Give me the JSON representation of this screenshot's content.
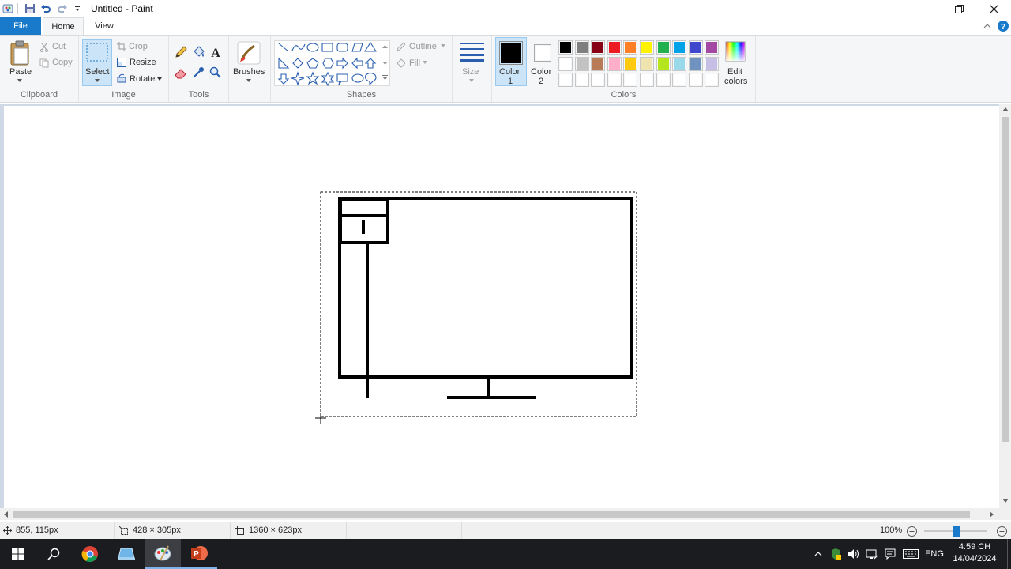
{
  "window": {
    "title": "Untitled - Paint"
  },
  "tabs": {
    "file": "File",
    "home": "Home",
    "view": "View"
  },
  "clipboard": {
    "paste": "Paste",
    "cut": "Cut",
    "copy": "Copy",
    "group": "Clipboard"
  },
  "image": {
    "select": "Select",
    "crop": "Crop",
    "resize": "Resize",
    "rotate": "Rotate",
    "group": "Image"
  },
  "tools": {
    "group": "Tools"
  },
  "brushes": {
    "label": "Brushes"
  },
  "shapes": {
    "outline": "Outline",
    "fill": "Fill",
    "group": "Shapes"
  },
  "size": {
    "label": "Size"
  },
  "colors": {
    "color1_l1": "Color",
    "color1_l2": "1",
    "color2_l1": "Color",
    "color2_l2": "2",
    "edit_l1": "Edit",
    "edit_l2": "colors",
    "group": "Colors",
    "color1_value": "#000000",
    "color2_value": "#ffffff",
    "palette_row1": [
      "#000000",
      "#7f7f7f",
      "#880015",
      "#ed1c24",
      "#ff7f27",
      "#fff200",
      "#22b14c",
      "#00a2e8",
      "#3f48cc",
      "#a349a4"
    ],
    "palette_row2": [
      "#ffffff",
      "#c3c3c3",
      "#b97a57",
      "#ffaec9",
      "#ffc90e",
      "#efe4b0",
      "#b5e61d",
      "#99d9ea",
      "#7092be",
      "#c8bfe7"
    ],
    "palette_row3": [
      "#ffffff",
      "#ffffff",
      "#ffffff",
      "#ffffff",
      "#ffffff",
      "#ffffff",
      "#ffffff",
      "#ffffff",
      "#ffffff",
      "#ffffff"
    ]
  },
  "status": {
    "cursor_pos": "855, 115px",
    "selection_size": "428 × 305px",
    "canvas_size": "1360 × 623px",
    "zoom": "100%"
  },
  "taskbar": {
    "lang": "ENG",
    "time": "4:59 CH",
    "date": "14/04/2024"
  },
  "accent": "#1979ca"
}
